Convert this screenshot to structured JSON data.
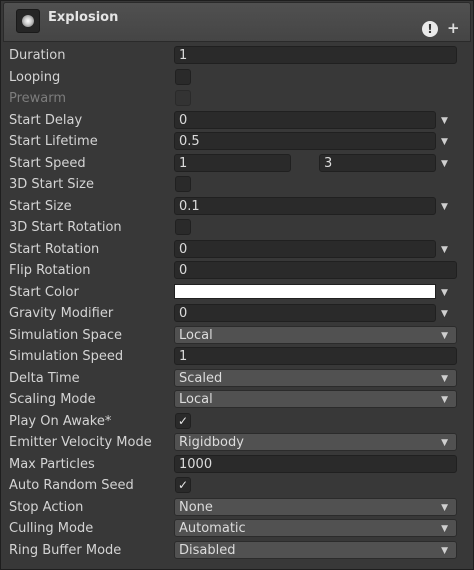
{
  "header": {
    "title": "Explosion",
    "info_icon": "!",
    "add_icon": "+"
  },
  "fields": {
    "duration": {
      "label": "Duration",
      "value": "1"
    },
    "looping": {
      "label": "Looping",
      "checked": false
    },
    "prewarm": {
      "label": "Prewarm",
      "checked": false,
      "disabled": true
    },
    "start_delay": {
      "label": "Start Delay",
      "value": "0"
    },
    "start_lifetime": {
      "label": "Start Lifetime",
      "value": "0.5"
    },
    "start_speed": {
      "label": "Start Speed",
      "min": "1",
      "max": "3"
    },
    "start_size_3d": {
      "label": "3D Start Size",
      "checked": false
    },
    "start_size": {
      "label": "Start Size",
      "value": "0.1"
    },
    "start_rotation_3d": {
      "label": "3D Start Rotation",
      "checked": false
    },
    "start_rotation": {
      "label": "Start Rotation",
      "value": "0"
    },
    "flip_rotation": {
      "label": "Flip Rotation",
      "value": "0"
    },
    "start_color": {
      "label": "Start Color",
      "color": "#ffffff"
    },
    "gravity_modifier": {
      "label": "Gravity Modifier",
      "value": "0"
    },
    "simulation_space": {
      "label": "Simulation Space",
      "value": "Local"
    },
    "simulation_speed": {
      "label": "Simulation Speed",
      "value": "1"
    },
    "delta_time": {
      "label": "Delta Time",
      "value": "Scaled"
    },
    "scaling_mode": {
      "label": "Scaling Mode",
      "value": "Local"
    },
    "play_on_awake": {
      "label": "Play On Awake*",
      "checked": true
    },
    "emitter_velocity_mode": {
      "label": "Emitter Velocity Mode",
      "value": "Rigidbody"
    },
    "max_particles": {
      "label": "Max Particles",
      "value": "1000"
    },
    "auto_random_seed": {
      "label": "Auto Random Seed",
      "checked": true
    },
    "stop_action": {
      "label": "Stop Action",
      "value": "None"
    },
    "culling_mode": {
      "label": "Culling Mode",
      "value": "Automatic"
    },
    "ring_buffer_mode": {
      "label": "Ring Buffer Mode",
      "value": "Disabled"
    }
  },
  "glyphs": {
    "check": "✓",
    "triangle": "▼"
  }
}
